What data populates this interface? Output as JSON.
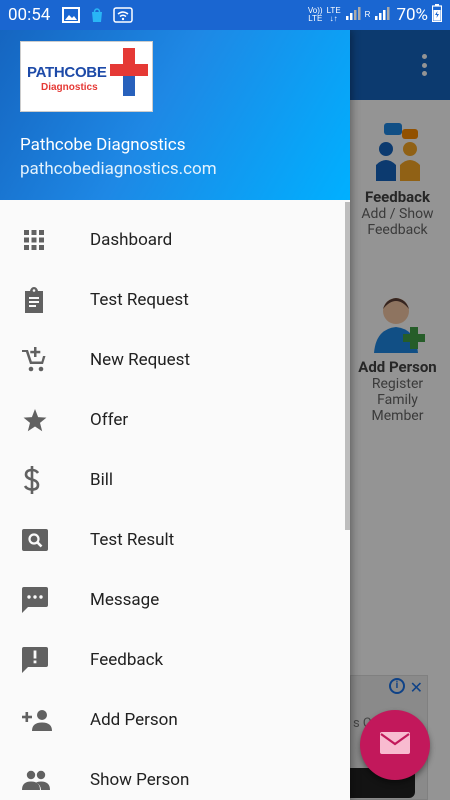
{
  "status_bar": {
    "time": "00:54",
    "volte_line1": "Vo))",
    "volte_line2": "LTE",
    "lte_label": "LTE",
    "roaming": "R",
    "battery_percent": "70%"
  },
  "drawer_header": {
    "logo_text": "PATHCOBE",
    "logo_subtext": "Diagnostics",
    "name": "Pathcobe Diagnostics",
    "email": "pathcobediagnostics.com"
  },
  "menu": {
    "items": [
      {
        "label": "Dashboard",
        "icon": "grid-icon"
      },
      {
        "label": "Test Request",
        "icon": "clipboard-icon"
      },
      {
        "label": "New Request",
        "icon": "add-cart-icon"
      },
      {
        "label": "Offer",
        "icon": "star-icon"
      },
      {
        "label": "Bill",
        "icon": "dollar-icon"
      },
      {
        "label": "Test Result",
        "icon": "search-box-icon"
      },
      {
        "label": "Message",
        "icon": "chat-icon"
      },
      {
        "label": "Feedback",
        "icon": "feedback-icon"
      },
      {
        "label": "Add Person",
        "icon": "add-person-icon"
      },
      {
        "label": "Show Person",
        "icon": "people-icon"
      }
    ]
  },
  "background": {
    "cards": [
      {
        "title": "Feedback",
        "line1": "Add / Show",
        "line2": "Feedback"
      },
      {
        "title": "Add Person",
        "line1": "Register",
        "line2": "Family",
        "line3": "Member"
      }
    ],
    "ad_partial_text": "s C"
  },
  "colors": {
    "status_bar": "#1a66d1",
    "toolbar": "#1565c0",
    "fab": "#c2185b",
    "icon_gray": "#616161"
  }
}
